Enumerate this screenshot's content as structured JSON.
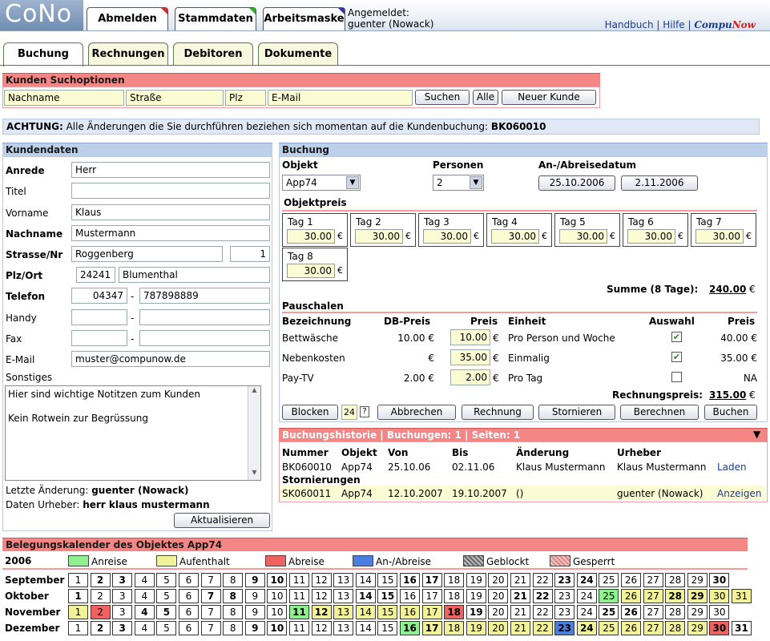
{
  "app": {
    "logo": "CoNo"
  },
  "top_tabs": [
    "Abmelden",
    "Stammdaten",
    "Arbeitsmaske"
  ],
  "logged_in": {
    "label": "Angemeldet:",
    "user": "guenter (Nowack)"
  },
  "top_links": {
    "manual": "Handbuch",
    "sep": "|",
    "help": "Hilfe",
    "brand_a": "Compu",
    "brand_b": "Now"
  },
  "main_tabs": [
    "Buchung",
    "Rechnungen",
    "Debitoren",
    "Dokumente"
  ],
  "search": {
    "title": "Kunden Suchoptionen",
    "nachname": "Nachname",
    "strasse": "Straße",
    "plz": "Plz",
    "email": "E-Mail",
    "btn_search": "Suchen",
    "btn_all": "Alle",
    "btn_new": "Neuer Kunde"
  },
  "notice": {
    "prefix": "ACHTUNG:",
    "text": "Alle Änderungen die Sie durchführen beziehen sich momentan auf die Kundenbuchung:",
    "code": "BK060010"
  },
  "customer": {
    "title": "Kundendaten",
    "anrede_l": "Anrede",
    "anrede": "Herr",
    "titel_l": "Titel",
    "titel": "",
    "vorname_l": "Vorname",
    "vorname": "Klaus",
    "nachname_l": "Nachname",
    "nachname": "Mustermann",
    "strasse_l": "Strasse/Nr",
    "strasse": "Roggenberg",
    "nr": "1",
    "plzort_l": "Plz/Ort",
    "plz": "24241",
    "ort": "Blumenthal",
    "telefon_l": "Telefon",
    "tel_pre": "04347",
    "tel": "787898889",
    "dash": "-",
    "handy_l": "Handy",
    "fax_l": "Fax",
    "email_l": "E-Mail",
    "email": "muster@compunow.de",
    "sonstiges_l": "Sonstiges",
    "notes1": "Hier sind wichtige Notitzen zum Kunden",
    "notes2": "Kein Rotwein zur Begrüssung",
    "last_change_l": "Letzte Änderung:",
    "last_change": "guenter (Nowack)",
    "origin_l": "Daten Urheber:",
    "origin": "herr klaus mustermann",
    "update_btn": "Aktualisieren"
  },
  "booking": {
    "title": "Buchung",
    "objekt_l": "Objekt",
    "objekt": "App74",
    "personen_l": "Personen",
    "personen": "2",
    "dates_l": "An-/Abreisedatum",
    "date_from": "25.10.2006",
    "date_to": "2.11.2006",
    "objektpreis_l": "Objektpreis",
    "days": [
      {
        "label": "Tag 1",
        "value": "30.00"
      },
      {
        "label": "Tag 2",
        "value": "30.00"
      },
      {
        "label": "Tag 3",
        "value": "30.00"
      },
      {
        "label": "Tag 4",
        "value": "30.00"
      },
      {
        "label": "Tag 5",
        "value": "30.00"
      },
      {
        "label": "Tag 6",
        "value": "30.00"
      },
      {
        "label": "Tag 7",
        "value": "30.00"
      },
      {
        "label": "Tag 8",
        "value": "30.00"
      }
    ],
    "euro": "€",
    "sum_l": "Summe (8 Tage):",
    "sum": "240.00",
    "pauschalen_l": "Pauschalen",
    "cols": {
      "bez": "Bezeichnung",
      "db": "DB-Preis",
      "preis": "Preis",
      "einheit": "Einheit",
      "auswahl": "Auswahl",
      "preis2": "Preis"
    },
    "rows": [
      {
        "bez": "Bettwäsche",
        "db": "10.00 €",
        "preis": "10.00",
        "einheit": "Pro Person und Woche",
        "checked": "✔",
        "total": "40.00 €"
      },
      {
        "bez": "Nebenkosten",
        "db": "€",
        "preis": "35.00",
        "einheit": "Einmalig",
        "checked": "✔",
        "total": "35.00 €"
      },
      {
        "bez": "Pay-TV",
        "db": "2.00 €",
        "preis": "2.00",
        "einheit": "Pro Tag",
        "checked": "",
        "total": "NA"
      }
    ],
    "invoice_l": "Rechnungspreis:",
    "invoice": "315.00",
    "btn_block": "Blocken",
    "block_days": "24",
    "q": "?",
    "btn_cancel": "Abbrechen",
    "btn_invoice": "Rechnung",
    "btn_storno": "Stornieren",
    "btn_calc": "Berechnen",
    "btn_book": "Buchen"
  },
  "history": {
    "title": "Buchungshistorie  |  Buchungen: 1 | Seiten: 1",
    "cols": [
      "Nummer",
      "Objekt",
      "Von",
      "Bis",
      "Änderung",
      "Urheber"
    ],
    "row": [
      "BK060010",
      "App74",
      "25.10.06",
      "02.11.06",
      "Klaus Mustermann",
      "Klaus Mustermann"
    ],
    "row_link": "Laden",
    "storno_l": "Stornierungen",
    "storno": [
      "SK060011",
      "App74",
      "12.10.2007",
      "19.10.2007",
      "()",
      "guenter (Nowack)"
    ],
    "storno_link": "Anzeigen"
  },
  "calendar": {
    "title": "Belegungskalender des Objektes App74",
    "year": "2006",
    "legend": [
      {
        "label": "Anreise",
        "color": "#8ef08e"
      },
      {
        "label": "Aufenthalt",
        "color": "#f2f29a"
      },
      {
        "label": "Abreise",
        "color": "#f06262"
      },
      {
        "label": "An-/Abreise",
        "color": "#4a7ee0"
      },
      {
        "label": "Geblockt",
        "color": "#888888"
      },
      {
        "label": "Gesperrt",
        "color": "#e8a0a0"
      }
    ],
    "months": [
      {
        "name": "September",
        "days": 30,
        "bold": [
          2,
          3,
          9,
          10,
          16,
          17,
          23,
          24,
          30
        ],
        "marks": {}
      },
      {
        "name": "Oktober",
        "days": 31,
        "bold": [
          1,
          7,
          8,
          14,
          15,
          21,
          22,
          28,
          29
        ],
        "marks": {
          "25": "#8ef08e",
          "26": "#f2f29a",
          "27": "#f2f29a",
          "28": "#f2f29a",
          "29": "#f2f29a",
          "30": "#f2f29a",
          "31": "#f2f29a"
        }
      },
      {
        "name": "November",
        "days": 30,
        "bold": [
          4,
          5,
          11,
          12,
          18,
          19,
          25,
          26
        ],
        "marks": {
          "1": "#f2f29a",
          "2": "#f06262",
          "11": "#8ef08e",
          "12": "#f2f29a",
          "13": "#f2f29a",
          "14": "#f2f29a",
          "15": "#f2f29a",
          "16": "#f2f29a",
          "17": "#f2f29a",
          "18": "#f06262"
        }
      },
      {
        "name": "Dezember",
        "days": 31,
        "bold": [
          2,
          3,
          9,
          10,
          16,
          17,
          23,
          24,
          30,
          31
        ],
        "marks": {
          "16": "#8ef08e",
          "17": "#f2f29a",
          "18": "#f2f29a",
          "19": "#f2f29a",
          "20": "#f2f29a",
          "21": "#f2f29a",
          "22": "#f2f29a",
          "23": "#4a7ee0",
          "24": "#f2f29a",
          "25": "#f2f29a",
          "26": "#f2f29a",
          "27": "#f2f29a",
          "28": "#f2f29a",
          "29": "#f2f29a",
          "30": "#f06262"
        }
      }
    ]
  }
}
